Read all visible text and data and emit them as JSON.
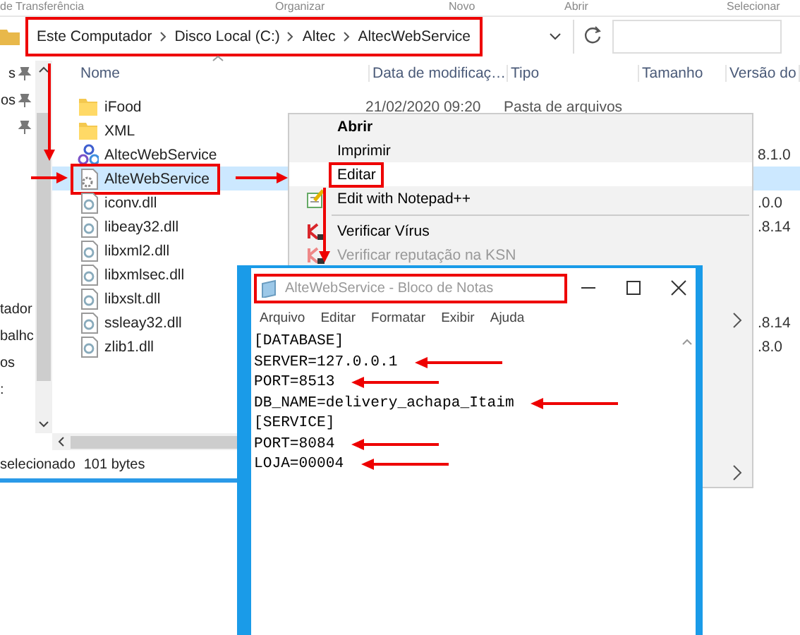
{
  "explorer": {
    "ribbon_labels": [
      "de Transferência",
      "Organizar",
      "Novo",
      "Abrir",
      "Selecionar"
    ],
    "breadcrumb": {
      "items": [
        "Este Computador",
        "Disco Local (C:)",
        "Altec",
        "AltecWebService"
      ],
      "highlighted": true
    },
    "nav_pinned": [
      {
        "label": "s",
        "pinned": true
      },
      {
        "label": "os",
        "pinned": true
      },
      {
        "pinned": true
      }
    ],
    "nav_lower": [
      "tador",
      "balhc",
      "os",
      ":"
    ],
    "columns": [
      "Nome",
      "Data de modificaç…",
      "Tipo",
      "Tamanho",
      "Versão do"
    ],
    "files": [
      {
        "name": "iFood",
        "kind": "folder",
        "selected": false,
        "highlighted": false,
        "date": "21/02/2020 09:20",
        "type": "Pasta de arquivos"
      },
      {
        "name": "XML",
        "kind": "folder",
        "selected": false,
        "highlighted": false
      },
      {
        "name": "AltecWebService",
        "kind": "app",
        "selected": false,
        "highlighted": false,
        "version": "8.1.0"
      },
      {
        "name": "AlteWebService",
        "kind": "config",
        "selected": true,
        "highlighted": true
      },
      {
        "name": "iconv.dll",
        "kind": "dll",
        "selected": false,
        "highlighted": false,
        "version": ".0.0"
      },
      {
        "name": "libeay32.dll",
        "kind": "dll",
        "selected": false,
        "highlighted": false,
        "version": ".8.14"
      },
      {
        "name": "libxml2.dll",
        "kind": "dll",
        "selected": false,
        "highlighted": false
      },
      {
        "name": "libxmlsec.dll",
        "kind": "dll",
        "selected": false,
        "highlighted": false
      },
      {
        "name": "libxslt.dll",
        "kind": "dll",
        "selected": false,
        "highlighted": false
      },
      {
        "name": "ssleay32.dll",
        "kind": "dll",
        "selected": false,
        "highlighted": false,
        "version": ".8.14"
      },
      {
        "name": "zlib1.dll",
        "kind": "dll",
        "selected": false,
        "highlighted": false,
        "version": ".8.0"
      }
    ],
    "status": {
      "selection": "selecionado",
      "size": "101 bytes"
    }
  },
  "context_menu": {
    "items": [
      {
        "kind": "default",
        "label": "Abrir",
        "selected": false,
        "disabled": false,
        "highlighted": false
      },
      {
        "kind": "item",
        "label": "Imprimir",
        "selected": false,
        "disabled": false,
        "highlighted": false
      },
      {
        "kind": "item",
        "label": "Editar",
        "selected": true,
        "disabled": false,
        "highlighted": true
      },
      {
        "kind": "notepadpp",
        "label": "Edit with Notepad++",
        "selected": false,
        "disabled": false,
        "highlighted": false
      },
      {
        "kind": "separator"
      },
      {
        "kind": "kaspersky",
        "label": "Verificar Vírus",
        "selected": false,
        "disabled": false,
        "highlighted": false
      },
      {
        "kind": "kaspersky",
        "label": "Verificar reputação na KSN",
        "selected": false,
        "disabled": true,
        "highlighted": false
      }
    ]
  },
  "notepad": {
    "title": "AlteWebService - Bloco de Notas",
    "highlighted": true,
    "menu": [
      "Arquivo",
      "Editar",
      "Formatar",
      "Exibir",
      "Ajuda"
    ],
    "lines": [
      {
        "text": "[DATABASE]",
        "arrow": false
      },
      {
        "text": "SERVER=127.0.0.1",
        "arrow": true
      },
      {
        "text": "PORT=8513",
        "arrow": true
      },
      {
        "text": "DB_NAME=delivery_achapa_Itaim",
        "arrow": true
      },
      {
        "text": "[SERVICE]",
        "arrow": false
      },
      {
        "text": "PORT=8084",
        "arrow": true
      },
      {
        "text": "LOJA=00004",
        "arrow": true
      }
    ]
  },
  "annotation_arrows": true
}
